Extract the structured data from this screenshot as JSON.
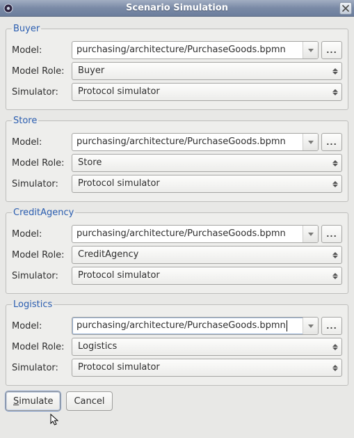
{
  "window": {
    "title": "Scenario Simulation"
  },
  "labels": {
    "model": "Model:",
    "model_role": "Model Role:",
    "simulator": "Simulator:",
    "browse": "..."
  },
  "groups": [
    {
      "legend": "Buyer",
      "model": "purchasing/architecture/PurchaseGoods.bpmn",
      "role": "Buyer",
      "simulator": "Protocol simulator",
      "focused": false
    },
    {
      "legend": "Store",
      "model": "purchasing/architecture/PurchaseGoods.bpmn",
      "role": "Store",
      "simulator": "Protocol simulator",
      "focused": false
    },
    {
      "legend": "CreditAgency",
      "model": "purchasing/architecture/PurchaseGoods.bpmn",
      "role": "CreditAgency",
      "simulator": "Protocol simulator",
      "focused": false
    },
    {
      "legend": "Logistics",
      "model": "purchasing/architecture/PurchaseGoods.bpmn",
      "role": "Logistics",
      "simulator": "Protocol simulator",
      "focused": true
    }
  ],
  "buttons": {
    "simulate": "Simulate",
    "cancel": "Cancel"
  }
}
